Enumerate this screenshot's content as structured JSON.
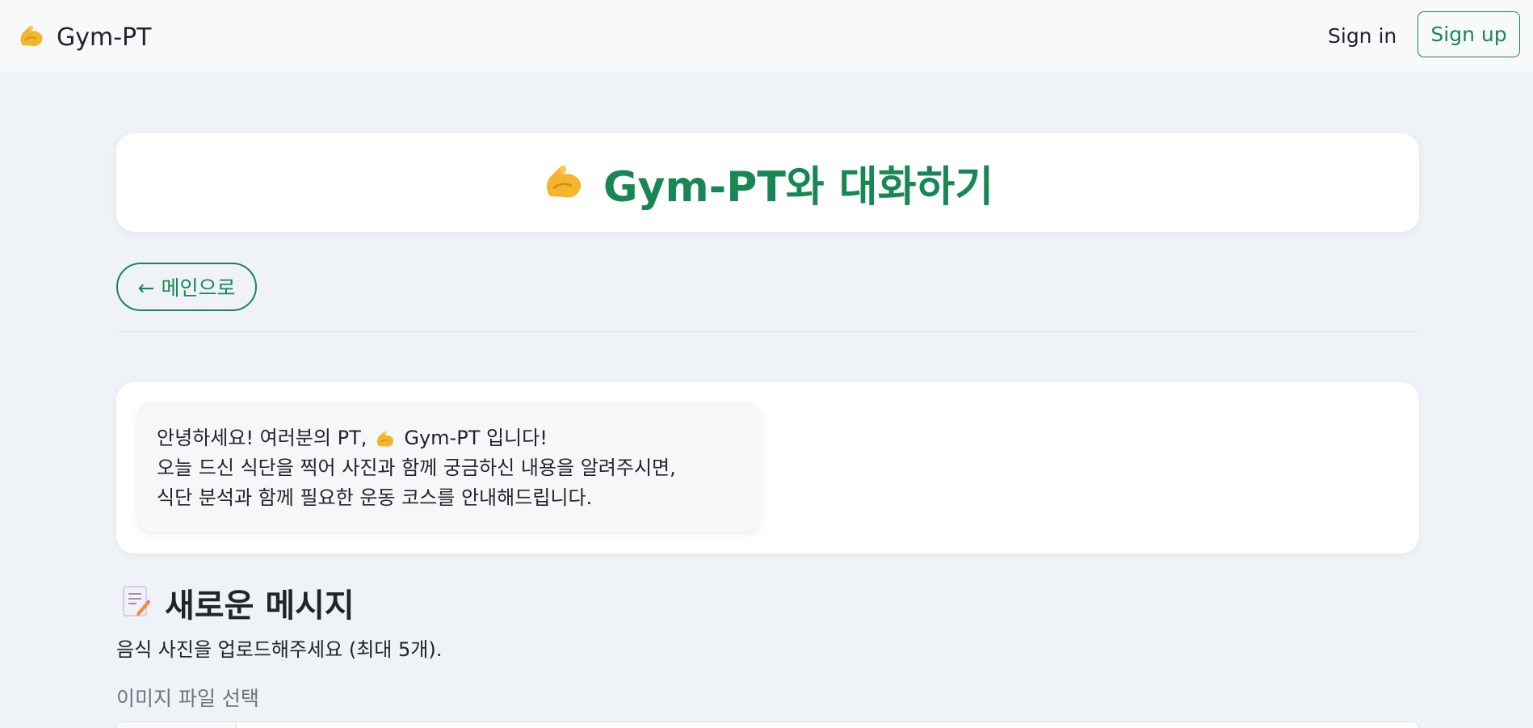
{
  "navbar": {
    "brand_icon": "flexed-biceps-icon",
    "brand_label": "Gym-PT",
    "signin_label": "Sign in",
    "signup_label": "Sign up"
  },
  "header": {
    "icon": "flexed-biceps-icon",
    "title": "Gym-PT와 대화하기"
  },
  "back_button": {
    "label": "← 메인으로"
  },
  "chat": {
    "messages": [
      {
        "line1_before": "안녕하세요! 여러분의 PT,",
        "line1_after": "Gym-PT 입니다!",
        "line2": "오늘 드신 식단을 찍어 사진과 함께 궁금하신 내용을 알려주시면,",
        "line3": "식단 분석과 함께 필요한 운동 코스를 안내해드립니다."
      }
    ]
  },
  "new_message": {
    "icon": "memo-icon",
    "title": "새로운 메시지",
    "description": "음식 사진을 업로드해주세요 (최대 5개).",
    "file_label": "이미지 파일 선택"
  },
  "colors": {
    "accent": "#198754",
    "background": "#eff2f6",
    "navbar": "#f8f9fa"
  }
}
